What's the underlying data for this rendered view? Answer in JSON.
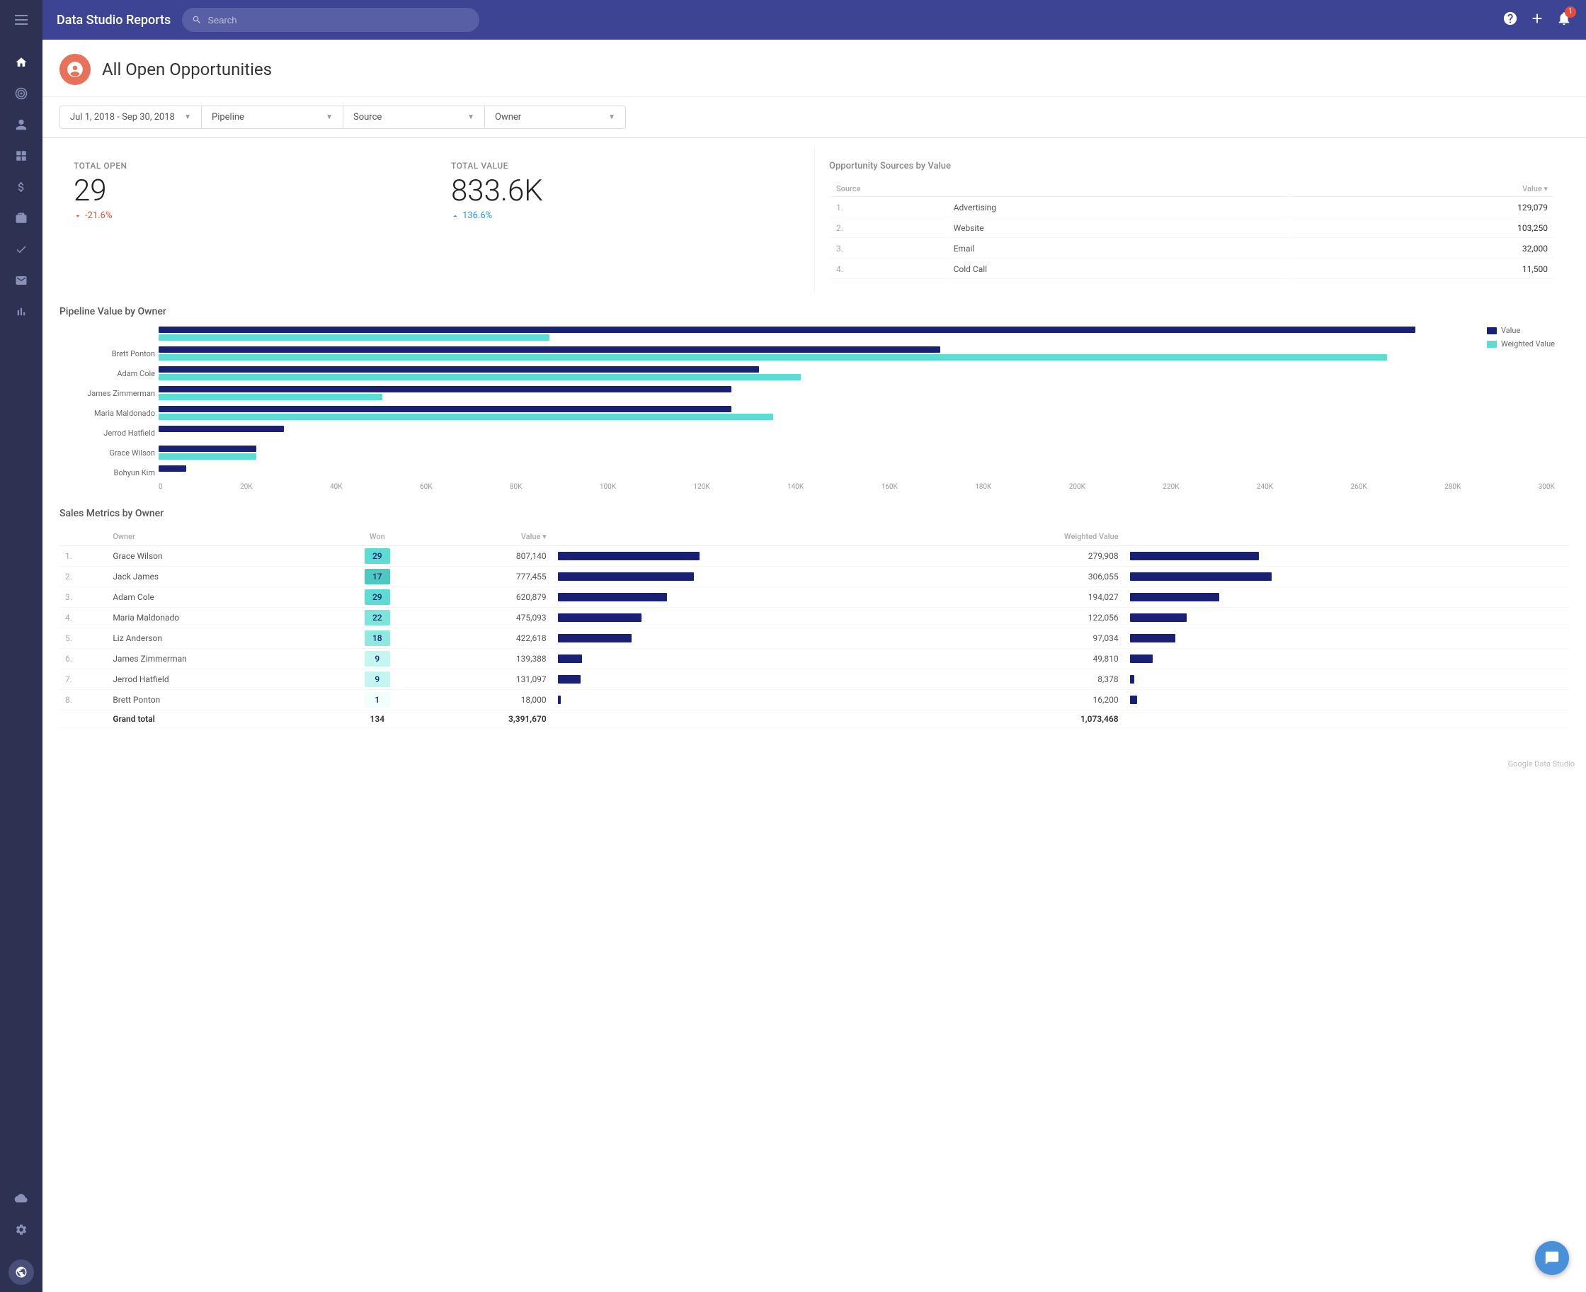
{
  "app": {
    "title": "Data Studio Reports",
    "search_placeholder": "Search"
  },
  "sidebar": {
    "icons": [
      {
        "name": "menu-icon",
        "symbol": "☰"
      },
      {
        "name": "home-icon",
        "symbol": "⌂"
      },
      {
        "name": "location-icon",
        "symbol": "◎"
      },
      {
        "name": "person-icon",
        "symbol": "👤"
      },
      {
        "name": "grid-icon",
        "symbol": "▦"
      },
      {
        "name": "dollar-icon",
        "symbol": "$"
      },
      {
        "name": "briefcase-icon",
        "symbol": "💼"
      },
      {
        "name": "check-icon",
        "symbol": "✓"
      },
      {
        "name": "mail-icon",
        "symbol": "✉"
      },
      {
        "name": "chart-icon",
        "symbol": "▐"
      }
    ],
    "bottom_icons": [
      {
        "name": "cloud-icon",
        "symbol": "☁"
      },
      {
        "name": "settings-icon",
        "symbol": "⚙"
      }
    ]
  },
  "topbar": {
    "notification_count": "1"
  },
  "page": {
    "title": "All Open Opportunities",
    "logo_symbol": "◑"
  },
  "filters": [
    {
      "label": "Jul 1, 2018 - Sep 30, 2018"
    },
    {
      "label": "Pipeline"
    },
    {
      "label": "Source"
    },
    {
      "label": "Owner"
    }
  ],
  "stats": {
    "total_open": {
      "label": "Total Open",
      "value": "29",
      "change": "-21.6%",
      "direction": "down"
    },
    "total_value": {
      "label": "Total Value",
      "value": "833.6K",
      "change": "136.6%",
      "direction": "up"
    }
  },
  "opp_sources": {
    "title": "Opportunity Sources by Value",
    "columns": [
      "Source",
      "Value"
    ],
    "rows": [
      {
        "rank": "1.",
        "source": "Advertising",
        "value": "129,079"
      },
      {
        "rank": "2.",
        "source": "Website",
        "value": "103,250"
      },
      {
        "rank": "3.",
        "source": "Email",
        "value": "32,000"
      },
      {
        "rank": "4.",
        "source": "Cold Call",
        "value": "11,500"
      }
    ]
  },
  "pipeline_chart": {
    "title": "Pipeline Value by Owner",
    "legend": [
      {
        "label": "Value",
        "color": "#1a2175"
      },
      {
        "label": "Weighted Value",
        "color": "#5cdcd2"
      }
    ],
    "rows": [
      {
        "name": "",
        "value_pct": 90,
        "weighted_pct": 28
      },
      {
        "name": "Brett Ponton",
        "value_pct": 56,
        "weighted_pct": 88
      },
      {
        "name": "Adam Cole",
        "value_pct": 43,
        "weighted_pct": 46
      },
      {
        "name": "James Zimmerman",
        "value_pct": 41,
        "weighted_pct": 16
      },
      {
        "name": "Maria Maldonado",
        "value_pct": 41,
        "weighted_pct": 44
      },
      {
        "name": "Jerrod Hatfield",
        "value_pct": 9,
        "weighted_pct": 0
      },
      {
        "name": "Grace Wilson",
        "value_pct": 7,
        "weighted_pct": 7
      },
      {
        "name": "Bohyun Kim",
        "value_pct": 2,
        "weighted_pct": 0
      }
    ],
    "x_labels": [
      "0",
      "20K",
      "40K",
      "60K",
      "80K",
      "100K",
      "120K",
      "140K",
      "160K",
      "180K",
      "200K",
      "220K",
      "240K",
      "260K",
      "280K",
      "300K"
    ]
  },
  "sales_metrics": {
    "title": "Sales Metrics by Owner",
    "columns": [
      "",
      "Owner",
      "Won",
      "Value ▾",
      "",
      "Weighted Value",
      ""
    ],
    "rows": [
      {
        "rank": "1.",
        "owner": "Grace Wilson",
        "won": 29,
        "won_color": "#5cdcd2",
        "value": "807,140",
        "value_pct": 100,
        "weighted": "279,908",
        "weighted_pct": 87
      },
      {
        "rank": "2.",
        "owner": "Jack James",
        "won": 17,
        "won_color": "#4dc9bf",
        "value": "777,455",
        "value_pct": 96,
        "weighted": "306,055",
        "weighted_pct": 95
      },
      {
        "rank": "3.",
        "owner": "Adam Cole",
        "won": 29,
        "won_color": "#5cdcd2",
        "value": "620,879",
        "value_pct": 77,
        "weighted": "194,027",
        "weighted_pct": 60
      },
      {
        "rank": "4.",
        "owner": "Maria Maldonado",
        "won": 22,
        "won_color": "#7de5dc",
        "value": "475,093",
        "value_pct": 59,
        "weighted": "122,056",
        "weighted_pct": 38
      },
      {
        "rank": "5.",
        "owner": "Liz Anderson",
        "won": 18,
        "won_color": "#8eeae1",
        "value": "422,618",
        "value_pct": 52,
        "weighted": "97,034",
        "weighted_pct": 30
      },
      {
        "rank": "6.",
        "owner": "James Zimmerman",
        "won": 9,
        "won_color": "#c5f5f1",
        "value": "139,388",
        "value_pct": 17,
        "weighted": "49,810",
        "weighted_pct": 15
      },
      {
        "rank": "7.",
        "owner": "Jerrod Hatfield",
        "won": 9,
        "won_color": "#c5f5f1",
        "value": "131,097",
        "value_pct": 16,
        "weighted": "8,378",
        "weighted_pct": 3
      },
      {
        "rank": "8.",
        "owner": "Brett Ponton",
        "won": 1,
        "won_color": "#f0fffe",
        "value": "18,000",
        "value_pct": 2,
        "weighted": "16,200",
        "weighted_pct": 5
      }
    ],
    "totals": {
      "label": "Grand total",
      "won": "134",
      "value": "3,391,670",
      "weighted": "1,073,468"
    }
  },
  "watermark": "Google Data Studio"
}
